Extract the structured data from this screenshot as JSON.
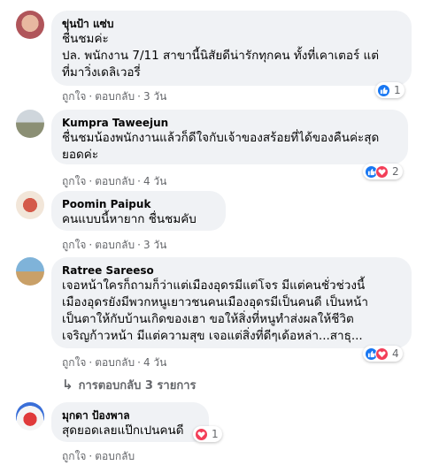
{
  "comments": [
    {
      "name": "ขุ่นป้า แซ่บ",
      "lines": [
        "ชื่นชมค่ะ",
        "ปล. พนักงาน 7/11 สาขานี้นิสัยดีน่ารักทุกคน ทั้งที่เคาเตอร์ แต่",
        "ที่มาวิ่งเดลิเวอรี่"
      ],
      "like_label": "ถูกใจ",
      "reply_label": "ตอบกลับ",
      "time": "3 วัน",
      "reaction_count": "1"
    },
    {
      "name": "Kumpra Taweejun",
      "lines": [
        "ชื่นชมน้องพนักงานแล้วก็ดีใจกับเจ้าของสร้อยที่ได้ของคืนค่ะสุด",
        "ยอดค่ะ"
      ],
      "like_label": "ถูกใจ",
      "reply_label": "ตอบกลับ",
      "time": "4 วัน",
      "reaction_count": "2"
    },
    {
      "name": "Poomin Paipuk",
      "lines": [
        "คนแบบนี้หายาก ชื่นชมคับ"
      ],
      "like_label": "ถูกใจ",
      "reply_label": "ตอบกลับ",
      "time": "3 วัน"
    },
    {
      "name": "Ratree Sareeso",
      "lines": [
        "เจอหน้าใครก็ถามก็ว่าแต่เมืองอุดรมีแต่โจร มีแต่คนชั่วช่วงนี้",
        "เมืองอุดรยังมีพวกหนูเยาวชนคนเมืองอุดรมีเป็นคนดี เป็นหน้า",
        "เป็นตาให้กับบ้านเกิดของเฮา ขอให้สิ่งที่หนูทำส่งผลให้ชีวิต",
        "เจริญก้าวหน้า มีแต่ความสุข เจอแต่สิ่งที่ดีๆเด้อหล่า...สาธุ..."
      ],
      "like_label": "ถูกใจ",
      "reply_label": "ตอบกลับ",
      "time": "4 วัน",
      "reaction_count": "4"
    },
    {
      "name": "มุกดา ป้องพาล",
      "lines": [
        "สุดยอดเลยแป๊กเปนคนดี"
      ],
      "like_label": "ถูกใจ",
      "reply_label": "ตอบกลับ",
      "reaction_count": "1"
    }
  ],
  "view_replies": "การตอบกลับ 3 รายการ",
  "colors": {
    "like": "#1877f2",
    "love": "#f33e58",
    "bubble": "#f0f2f5"
  }
}
